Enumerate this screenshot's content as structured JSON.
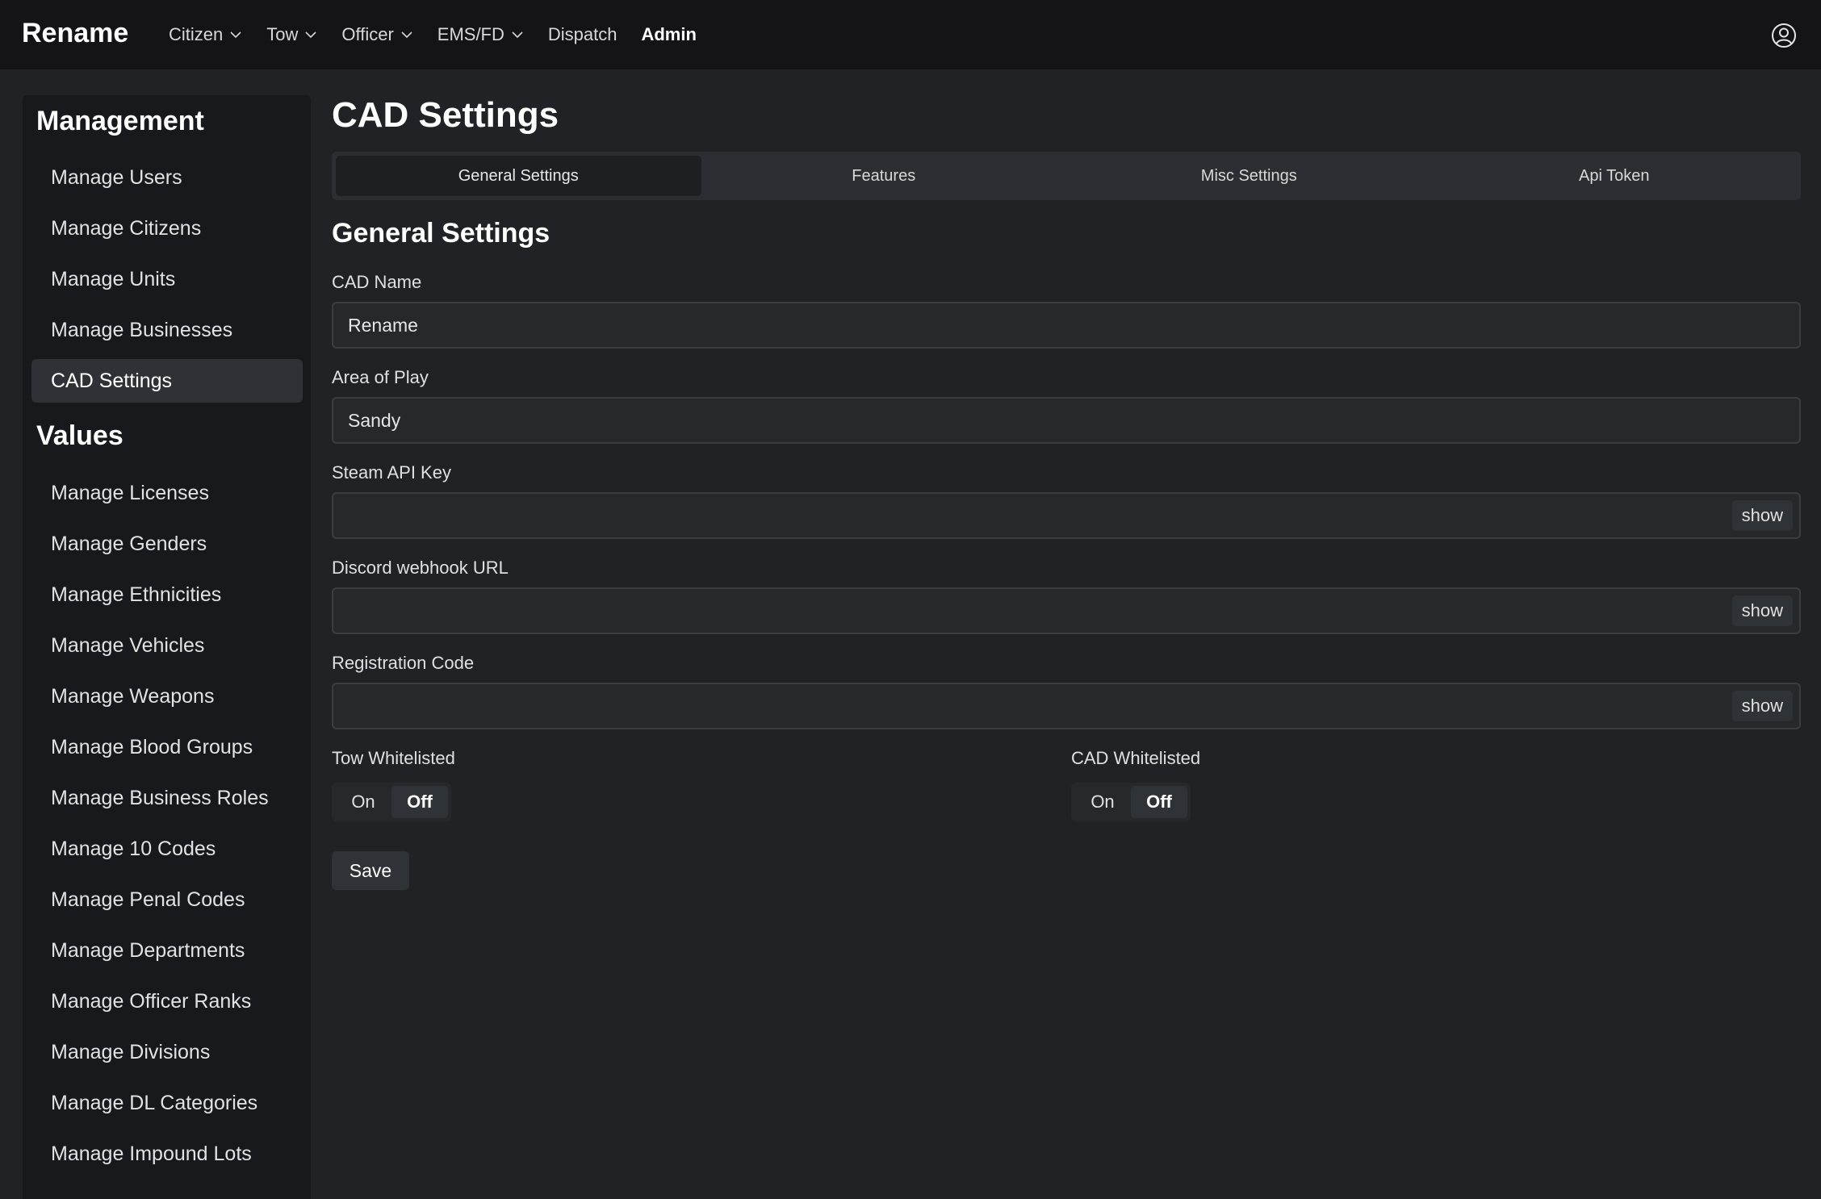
{
  "navbar": {
    "brand": "Rename",
    "links": [
      {
        "label": "Citizen",
        "dropdown": true
      },
      {
        "label": "Tow",
        "dropdown": true
      },
      {
        "label": "Officer",
        "dropdown": true
      },
      {
        "label": "EMS/FD",
        "dropdown": true
      },
      {
        "label": "Dispatch",
        "dropdown": false
      },
      {
        "label": "Admin",
        "dropdown": false,
        "active": true
      }
    ],
    "user_icon": "user-circle-icon"
  },
  "sidebar": {
    "management_heading": "Management",
    "management_items": [
      {
        "label": "Manage Users"
      },
      {
        "label": "Manage Citizens"
      },
      {
        "label": "Manage Units"
      },
      {
        "label": "Manage Businesses"
      },
      {
        "label": "CAD Settings",
        "active": true
      }
    ],
    "values_heading": "Values",
    "values_items": [
      {
        "label": "Manage Licenses"
      },
      {
        "label": "Manage Genders"
      },
      {
        "label": "Manage Ethnicities"
      },
      {
        "label": "Manage Vehicles"
      },
      {
        "label": "Manage Weapons"
      },
      {
        "label": "Manage Blood Groups"
      },
      {
        "label": "Manage Business Roles"
      },
      {
        "label": "Manage 10 Codes"
      },
      {
        "label": "Manage Penal Codes"
      },
      {
        "label": "Manage Departments"
      },
      {
        "label": "Manage Officer Ranks"
      },
      {
        "label": "Manage Divisions"
      },
      {
        "label": "Manage DL Categories"
      },
      {
        "label": "Manage Impound Lots"
      }
    ]
  },
  "main": {
    "page_title": "CAD Settings",
    "tabs": [
      {
        "label": "General Settings",
        "active": true
      },
      {
        "label": "Features"
      },
      {
        "label": "Misc Settings"
      },
      {
        "label": "Api Token"
      }
    ],
    "section_title": "General Settings",
    "fields": {
      "cad_name": {
        "label": "CAD Name",
        "value": "Rename"
      },
      "area_of_play": {
        "label": "Area of Play",
        "value": "Sandy"
      },
      "steam_api_key": {
        "label": "Steam API Key",
        "value": "",
        "show_label": "show"
      },
      "discord_webhook": {
        "label": "Discord webhook URL",
        "value": "",
        "show_label": "show"
      },
      "registration_code": {
        "label": "Registration Code",
        "value": "",
        "show_label": "show"
      }
    },
    "toggles": {
      "tow_whitelisted": {
        "label": "Tow Whitelisted",
        "on_label": "On",
        "off_label": "Off",
        "selected": "Off"
      },
      "cad_whitelisted": {
        "label": "CAD Whitelisted",
        "on_label": "On",
        "off_label": "Off",
        "selected": "Off"
      }
    },
    "save_label": "Save"
  },
  "colors": {
    "navbar_bg": "#141416",
    "page_bg": "#202226",
    "sidebar_bg": "#18191c",
    "active_item_bg": "#2f3136",
    "input_bg": "#26282c"
  }
}
